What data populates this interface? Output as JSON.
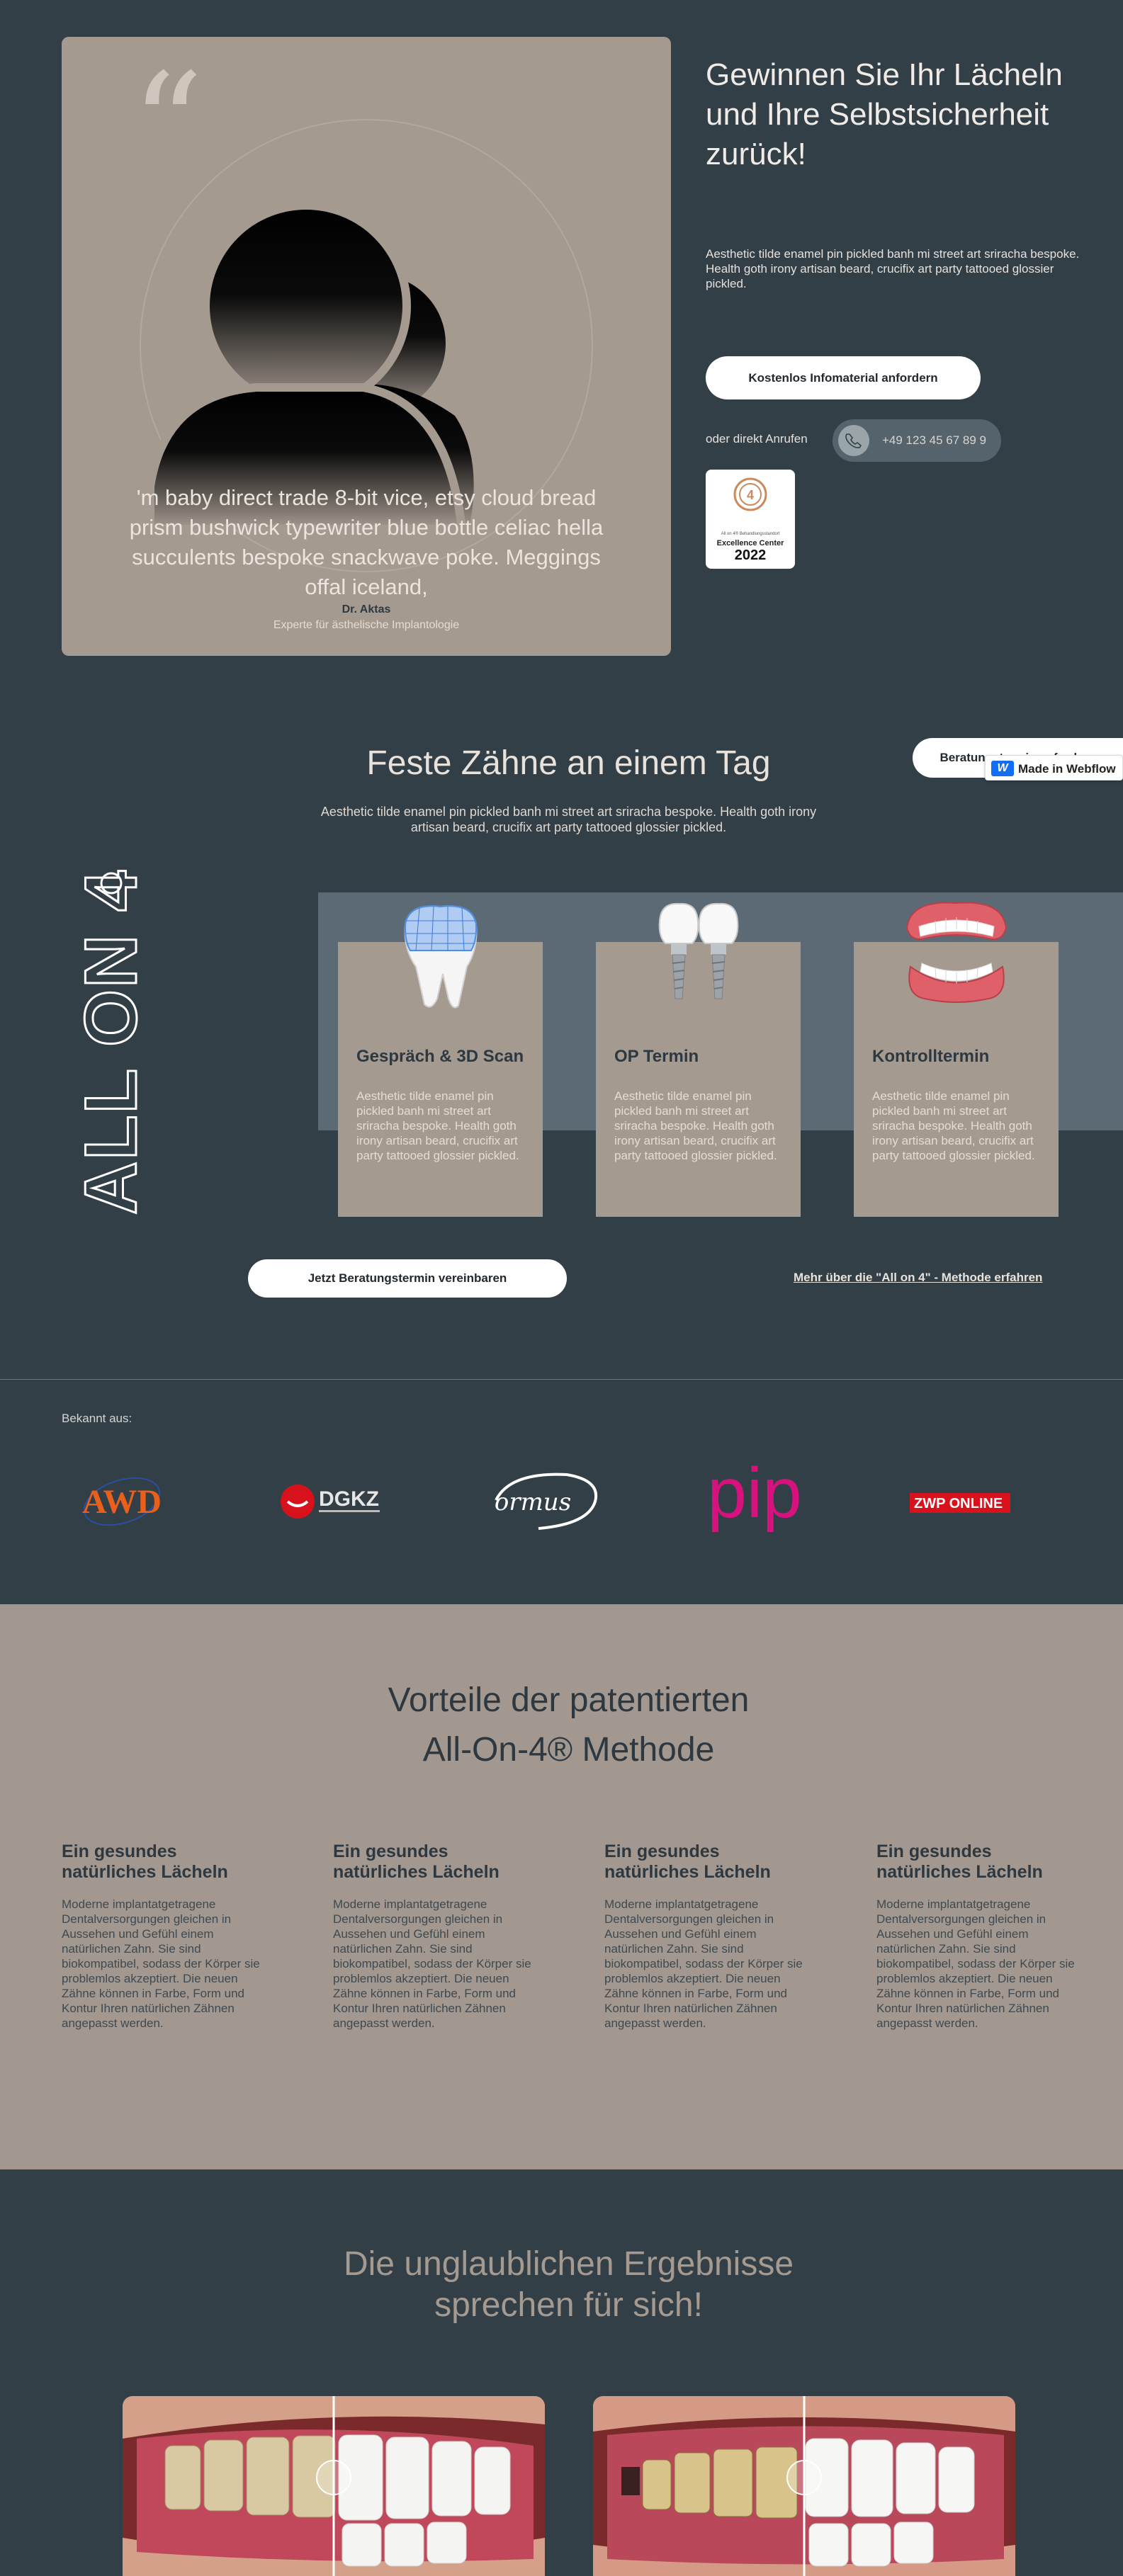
{
  "hero": {
    "quote": "'m baby direct trade 8-bit vice, etsy cloud bread prism bushwick typewriter blue bottle celiac hella succulents bespoke snackwave poke. Meggings offal iceland,",
    "quote_mark": "“",
    "author": "Dr. Aktas",
    "author_role": "Experte für ästhelische Implantologie",
    "title": "Gewinnen Sie Ihr Lächeln und Ihre Selbstsicherheit zurück!",
    "text": "Aesthetic tilde enamel pin pickled banh mi street art sriracha bespoke. Health goth irony artisan beard, crucifix art party tattooed glossier pickled.",
    "info_button": "Kostenlos Infomaterial anfordern",
    "call_label": "oder direkt Anrufen",
    "phone": "+49 123 45 67 89 9",
    "award": {
      "line1": "All on 4® Behandlungsstandort",
      "line2": "Excellence Center",
      "year": "2022"
    }
  },
  "allon4": {
    "title": "Feste Zähne an einem Tag",
    "text": "Aesthetic tilde enamel pin pickled banh mi street art sriracha bespoke. Health goth irony artisan beard, crucifix art party tattooed glossier pickled.",
    "floating_button": "Beratungstermin anfordern",
    "webflow_badge": "Made in Webflow",
    "vertical_logo": "ALL ON 4",
    "steps": [
      {
        "title": "Gespräch & 3D Scan",
        "text": "Aesthetic tilde enamel pin pickled banh mi street art sriracha bespoke. Health goth irony artisan beard, crucifix art party tattooed glossier pickled."
      },
      {
        "title": "OP Termin",
        "text": "Aesthetic tilde enamel pin pickled banh mi street art sriracha bespoke. Health goth irony artisan beard, crucifix art party tattooed glossier pickled."
      },
      {
        "title": "Kontrolltermin",
        "text": "Aesthetic tilde enamel pin pickled banh mi street art sriracha bespoke. Health goth irony artisan beard, crucifix art party tattooed glossier pickled."
      }
    ],
    "consult_button": "Jetzt Beratungstermin vereinbaren",
    "more_link": "Mehr über die \"All on 4\" - Methode erfahren"
  },
  "known": {
    "label": "Bekannt aus:",
    "logos": [
      "AWD",
      "DGKZ",
      "ormus",
      "pip",
      "ZWP ONLINE"
    ]
  },
  "benefits": {
    "title_line1": "Vorteile der patentierten",
    "title_line2": "All-On-4® Methode",
    "items": [
      {
        "title": "Ein gesundes natürliches Lächeln",
        "text": "Moderne implantatgetragene Dentalversorgungen gleichen in Aussehen und Gefühl einem natürlichen Zahn. Sie sind biokompatibel, sodass der Körper sie problemlos akzeptiert. Die neuen Zähne können in Farbe, Form und Kontur Ihren natürlichen Zähnen angepasst werden."
      },
      {
        "title": "Ein gesundes natürliches Lächeln",
        "text": "Moderne implantatgetragene Dentalversorgungen gleichen in Aussehen und Gefühl einem natürlichen Zahn. Sie sind biokompatibel, sodass der Körper sie problemlos akzeptiert. Die neuen Zähne können in Farbe, Form und Kontur Ihren natürlichen Zähnen angepasst werden."
      },
      {
        "title": "Ein gesundes natürliches Lächeln",
        "text": "Moderne implantatgetragene Dentalversorgungen gleichen in Aussehen und Gefühl einem natürlichen Zahn. Sie sind biokompatibel, sodass der Körper sie problemlos akzeptiert. Die neuen Zähne können in Farbe, Form und Kontur Ihren natürlichen Zähnen angepasst werden."
      },
      {
        "title": "Ein gesundes natürliches Lächeln",
        "text": "Moderne implantatgetragene Dentalversorgungen gleichen in Aussehen und Gefühl einem natürlichen Zahn. Sie sind biokompatibel, sodass der Körper sie problemlos akzeptiert. Die neuen Zähne können in Farbe, Form und Kontur Ihren natürlichen Zähnen angepasst werden."
      }
    ]
  },
  "results": {
    "title_line1": "Die unglaublichen Ergebnisse",
    "title_line2": "sprechen für sich!"
  },
  "colors": {
    "dark": "#333f47",
    "taupe": "#a59a90",
    "slate": "#5b6a74",
    "pip_pink": "#d6127f",
    "awd_orange": "#e8601c",
    "dgkz_red": "#d8121c"
  }
}
